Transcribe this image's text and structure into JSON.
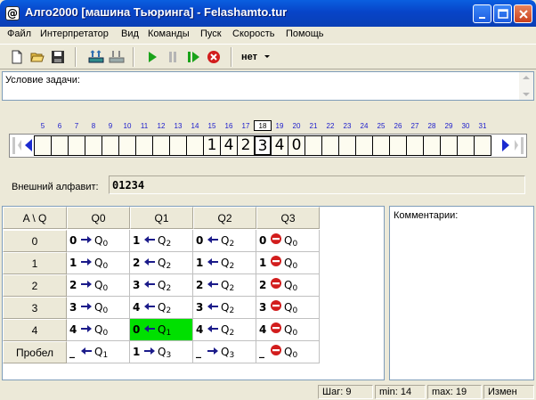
{
  "window": {
    "title": "Алго2000 [машина Тьюринга] - Felashamto.tur"
  },
  "menu": [
    "Файл",
    "Интерпретатор",
    "Вид",
    "Команды",
    "Пуск",
    "Скорость",
    "Помощь"
  ],
  "toolbar": {
    "speed_value": "нет"
  },
  "task": {
    "label": "Условие задачи:"
  },
  "tape": {
    "indices": [
      "5",
      "6",
      "7",
      "8",
      "9",
      "10",
      "11",
      "12",
      "13",
      "14",
      "15",
      "16",
      "17",
      "18",
      "19",
      "20",
      "21",
      "22",
      "23",
      "24",
      "25",
      "26",
      "27",
      "28",
      "29",
      "30",
      "31"
    ],
    "current_index": "18",
    "cells": [
      "",
      "",
      "",
      "",
      "",
      "",
      "",
      "",
      "",
      "",
      "1",
      "4",
      "2",
      "3",
      "4",
      "0",
      "",
      "",
      "",
      "",
      "",
      "",
      "",
      "",
      "",
      "",
      ""
    ]
  },
  "alphabet": {
    "label": "Внешний алфавит:",
    "value": "01234"
  },
  "table": {
    "corner": "A \\ Q",
    "states": [
      "Q0",
      "Q1",
      "Q2",
      "Q3"
    ],
    "rows": [
      {
        "symbol": "0",
        "cells": [
          {
            "w": "0",
            "d": "R",
            "s": "Q",
            "n": "0"
          },
          {
            "w": "1",
            "d": "L",
            "s": "Q",
            "n": "2"
          },
          {
            "w": "0",
            "d": "L",
            "s": "Q",
            "n": "2"
          },
          {
            "w": "0",
            "d": "S",
            "s": "Q",
            "n": "0"
          }
        ]
      },
      {
        "symbol": "1",
        "cells": [
          {
            "w": "1",
            "d": "R",
            "s": "Q",
            "n": "0"
          },
          {
            "w": "2",
            "d": "L",
            "s": "Q",
            "n": "2"
          },
          {
            "w": "1",
            "d": "L",
            "s": "Q",
            "n": "2"
          },
          {
            "w": "1",
            "d": "S",
            "s": "Q",
            "n": "0"
          }
        ]
      },
      {
        "symbol": "2",
        "cells": [
          {
            "w": "2",
            "d": "R",
            "s": "Q",
            "n": "0"
          },
          {
            "w": "3",
            "d": "L",
            "s": "Q",
            "n": "2"
          },
          {
            "w": "2",
            "d": "L",
            "s": "Q",
            "n": "2"
          },
          {
            "w": "2",
            "d": "S",
            "s": "Q",
            "n": "0"
          }
        ]
      },
      {
        "symbol": "3",
        "cells": [
          {
            "w": "3",
            "d": "R",
            "s": "Q",
            "n": "0"
          },
          {
            "w": "4",
            "d": "L",
            "s": "Q",
            "n": "2"
          },
          {
            "w": "3",
            "d": "L",
            "s": "Q",
            "n": "2"
          },
          {
            "w": "3",
            "d": "S",
            "s": "Q",
            "n": "0"
          }
        ]
      },
      {
        "symbol": "4",
        "cells": [
          {
            "w": "4",
            "d": "R",
            "s": "Q",
            "n": "0"
          },
          {
            "w": "0",
            "d": "L",
            "s": "Q",
            "n": "1",
            "hl": true
          },
          {
            "w": "4",
            "d": "L",
            "s": "Q",
            "n": "2"
          },
          {
            "w": "4",
            "d": "S",
            "s": "Q",
            "n": "0"
          }
        ]
      },
      {
        "symbol": "Пробел",
        "cells": [
          {
            "w": "_",
            "d": "L",
            "s": "Q",
            "n": "1"
          },
          {
            "w": "1",
            "d": "R",
            "s": "Q",
            "n": "3"
          },
          {
            "w": "_",
            "d": "R",
            "s": "Q",
            "n": "3"
          },
          {
            "w": "_",
            "d": "S",
            "s": "Q",
            "n": "0"
          }
        ]
      }
    ]
  },
  "comments": {
    "label": "Комментарии:"
  },
  "status": {
    "step": "Шаг:   9",
    "min": "min: 14",
    "max": "max: 19",
    "mode": "Измен"
  },
  "colors": {
    "highlight": "#00e000",
    "arrow": "#1b1b8a",
    "stop": "#d21d1d",
    "tape_index": "#1a1acc"
  },
  "icons": [
    "new-file-icon",
    "open-folder-icon",
    "save-disk-icon",
    "tape-up-icon",
    "tape-down-icon",
    "run-icon",
    "pause-icon",
    "step-icon",
    "stop-icon"
  ]
}
